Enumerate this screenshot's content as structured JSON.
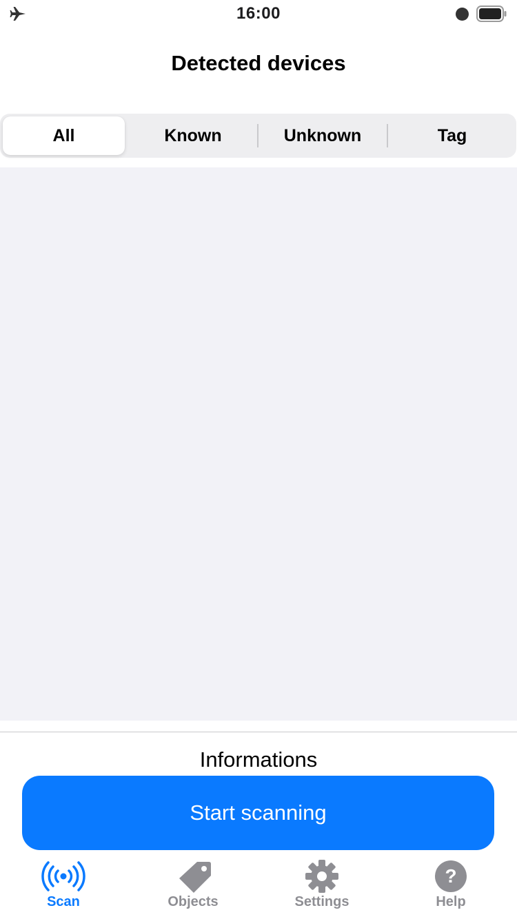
{
  "status_bar": {
    "time": "16:00",
    "airplane_icon": "airplane-icon",
    "battery_icon": "battery-icon"
  },
  "nav": {
    "title": "Detected devices"
  },
  "segments": [
    {
      "label": "All",
      "selected": true
    },
    {
      "label": "Known",
      "selected": false
    },
    {
      "label": "Unknown",
      "selected": false
    },
    {
      "label": "Tag",
      "selected": false
    }
  ],
  "device_list": {
    "items": []
  },
  "info": {
    "title": "Informations"
  },
  "action": {
    "start_label": "Start scanning"
  },
  "tabs": [
    {
      "label": "Scan",
      "icon": "scan-waves-icon",
      "active": true
    },
    {
      "label": "Objects",
      "icon": "tag-icon",
      "active": false
    },
    {
      "label": "Settings",
      "icon": "gear-icon",
      "active": false
    },
    {
      "label": "Help",
      "icon": "question-icon",
      "active": false
    }
  ],
  "colors": {
    "accent": "#0a7aff",
    "inactive": "#8e8e93",
    "list_background": "#f2f2f7"
  }
}
